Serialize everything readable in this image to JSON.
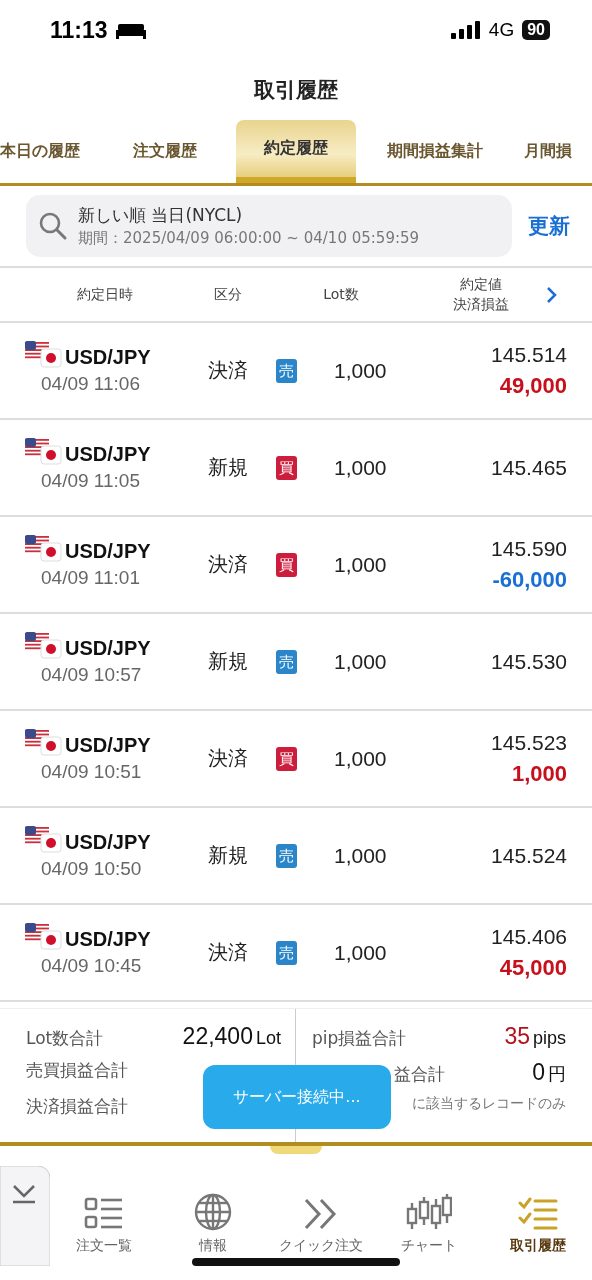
{
  "status_bar": {
    "time": "11:13",
    "network": "4G",
    "battery": "90"
  },
  "title": "取引履歴",
  "tabs": [
    {
      "label": "本日の履歴",
      "selected": false
    },
    {
      "label": "注文履歴",
      "selected": false
    },
    {
      "label": "約定履歴",
      "selected": true
    },
    {
      "label": "期間損益集計",
      "selected": false
    },
    {
      "label": "月間損",
      "selected": false
    }
  ],
  "filter": {
    "sort": "新しい順 当日(NYCL)",
    "period": "期間：2025/04/09 06:00:00 ~ 04/10 05:59:59",
    "refresh": "更新"
  },
  "table": {
    "columns": [
      {
        "lines": [
          "約定日時"
        ]
      },
      {
        "lines": [
          "区分"
        ]
      },
      {
        "lines": [
          "Lot数"
        ]
      },
      {
        "lines": [
          "約定値",
          "決済損益"
        ]
      }
    ],
    "rows": [
      {
        "pair": "USD/JPY",
        "time": "04/09 11:06",
        "type": "決済",
        "side": {
          "label": "売",
          "kind": "sell"
        },
        "lot": "1,000",
        "price": "145.514",
        "pnl": {
          "text": "49,000",
          "kind": "gain"
        }
      },
      {
        "pair": "USD/JPY",
        "time": "04/09 11:05",
        "type": "新規",
        "side": {
          "label": "買",
          "kind": "buy"
        },
        "lot": "1,000",
        "price": "145.465"
      },
      {
        "pair": "USD/JPY",
        "time": "04/09 11:01",
        "type": "決済",
        "side": {
          "label": "買",
          "kind": "buy"
        },
        "lot": "1,000",
        "price": "145.590",
        "pnl": {
          "text": "-60,000",
          "kind": "loss"
        }
      },
      {
        "pair": "USD/JPY",
        "time": "04/09 10:57",
        "type": "新規",
        "side": {
          "label": "売",
          "kind": "sell"
        },
        "lot": "1,000",
        "price": "145.530"
      },
      {
        "pair": "USD/JPY",
        "time": "04/09 10:51",
        "type": "決済",
        "side": {
          "label": "買",
          "kind": "buy"
        },
        "lot": "1,000",
        "price": "145.523",
        "pnl": {
          "text": "1,000",
          "kind": "gain"
        }
      },
      {
        "pair": "USD/JPY",
        "time": "04/09 10:50",
        "type": "新規",
        "side": {
          "label": "売",
          "kind": "sell"
        },
        "lot": "1,000",
        "price": "145.524"
      },
      {
        "pair": "USD/JPY",
        "time": "04/09 10:45",
        "type": "決済",
        "side": {
          "label": "売",
          "kind": "sell"
        },
        "lot": "1,000",
        "price": "145.406",
        "pnl": {
          "text": "45,000",
          "kind": "gain"
        }
      }
    ]
  },
  "summary": {
    "left": [
      {
        "label": "Lot数合計",
        "value": "22,400",
        "unit": "Lot"
      },
      {
        "label": "売買損益合計"
      },
      {
        "label": "決済損益合計"
      }
    ],
    "right": [
      {
        "label": "pip損益合計",
        "value": "35",
        "unit": "pips",
        "kind": "gain"
      },
      {
        "label": "益合計",
        "value": "0",
        "unit": "円"
      },
      {
        "note": "に該当するレコードのみ"
      }
    ]
  },
  "toast": "サーバー接続中...",
  "nav": [
    {
      "label": "注文一覧",
      "selected": false
    },
    {
      "label": "情報",
      "selected": false
    },
    {
      "label": "クイック注文",
      "selected": false
    },
    {
      "label": "チャート",
      "selected": false
    },
    {
      "label": "取引履歴",
      "selected": true
    }
  ]
}
